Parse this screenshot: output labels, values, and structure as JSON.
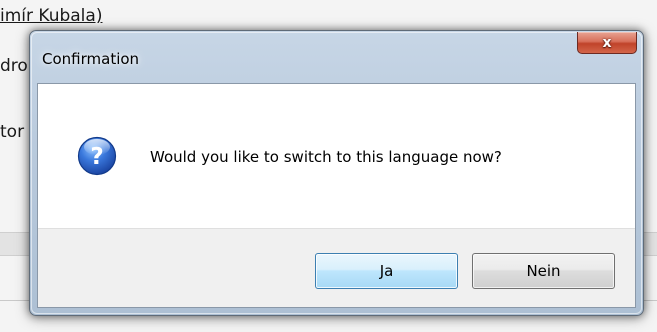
{
  "background": {
    "line1": "imír Kubala)",
    "line2": "dro",
    "line3": "tor"
  },
  "dialog": {
    "title": "Confirmation",
    "close_label": "x",
    "icon": "question-icon",
    "message": "Would you like to switch to this language now?",
    "buttons": {
      "yes_label": "Ja",
      "no_label": "Nein"
    }
  },
  "colors": {
    "frame": "#b9cadd",
    "close_button": "#c7462c",
    "default_button_border": "#3c7fb1",
    "question_icon": "#2a62c9"
  }
}
